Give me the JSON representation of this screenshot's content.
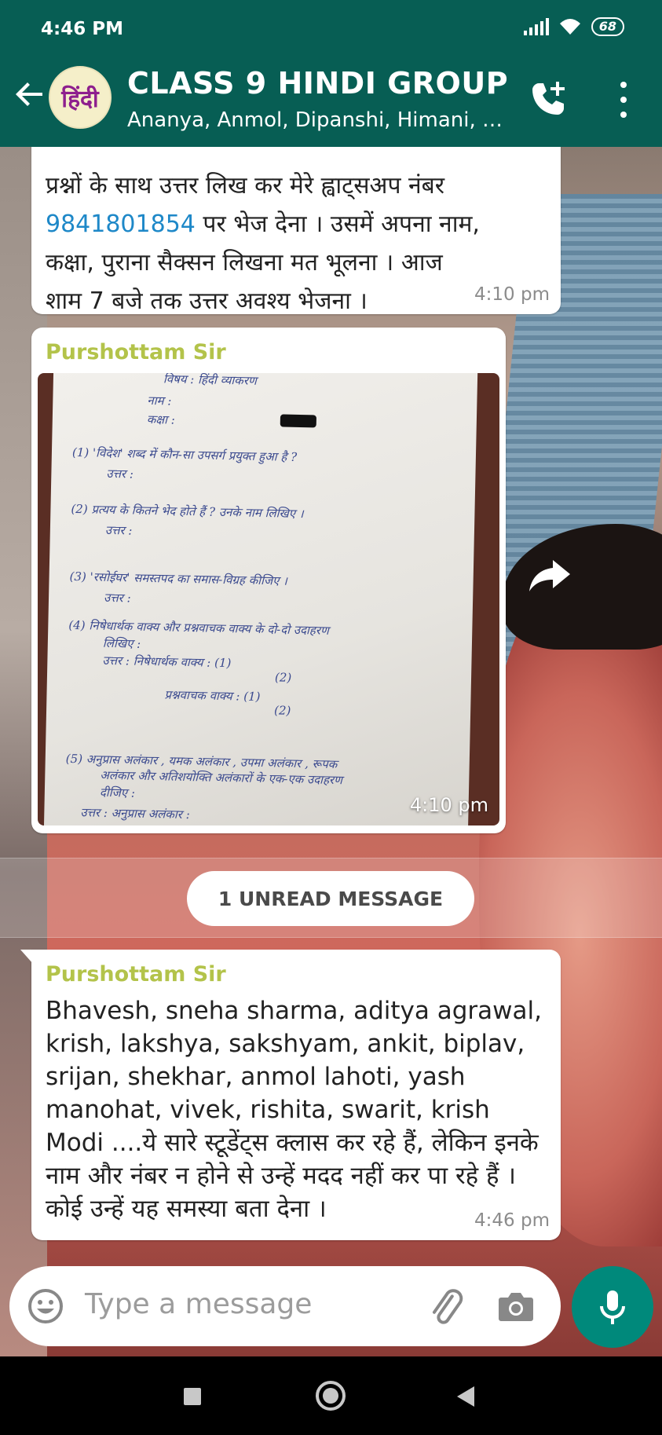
{
  "status_bar": {
    "time": "4:46 PM",
    "battery": "68"
  },
  "header": {
    "title": "CLASS 9 HINDI GROUP",
    "subtitle": "Ananya, Anmol, Dipanshi, Himani, Ka...",
    "avatar_text": "हिंदी",
    "icons": [
      "back-arrow-icon",
      "add-call-icon",
      "more-vert-icon"
    ]
  },
  "messages": [
    {
      "type": "text",
      "text_before": "प्रश्नों के साथ उत्तर लिख कर मेरे ह्वाट्सअप नंबर",
      "phone": "9841801854",
      "text_after_phone": " पर भेज देना । उसमें अपना नाम,",
      "line3": "कक्षा, पुराना सैक्सन लिखना मत भूलना । आज",
      "line4": "शाम 7 बजे तक उत्तर अवश्य भेजना ।",
      "time": "4:10 pm"
    },
    {
      "type": "image",
      "sender": "Purshottam Sir",
      "time": "4:10 pm",
      "worksheet_lines": [
        "विषय : हिंदी व्याकरण",
        "नाम :",
        "कक्षा :",
        "(1) 'विदेश' शब्द में कौन-सा उपसर्ग प्रयुक्त हुआ है ?",
        "उत्तर :",
        "(2) प्रत्यय के कितने भेद होते हैं ? उनके नाम लिखिए ।",
        "उत्तर :",
        "(3) 'रसोईघर' समस्तपद का समास-विग्रह कीजिए ।",
        "उत्तर :",
        "(4) निषेधार्थक वाक्य और प्रश्नवाचक वाक्य के दो-दो उदाहरण",
        "लिखिए :",
        "उत्तर : निषेधार्थक वाक्य : (1)",
        "(2)",
        "प्रश्नवाचक वाक्य : (1)",
        "(2)",
        "(5) अनुप्रास अलंकार , यमक अलंकार , उपमा अलंकार , रूपक",
        "अलंकार और अतिशयोक्ति अलंकारों के एक-एक उदाहरण",
        "दीजिए :",
        "उत्तर : अनुप्रास अलंकार :"
      ]
    },
    {
      "type": "text",
      "sender": "Purshottam Sir",
      "body": "Bhavesh, sneha sharma, aditya agrawal, krish, lakshya, sakshyam, ankit, biplav, srijan, shekhar, anmol lahoti,  yash manohat, vivek, rishita, swarit, krish Modi ....ये सारे स्टूडेंट्स क्लास कर रहे हैं, लेकिन इनके नाम और नंबर न होने से उन्हें मदद नहीं कर पा रहे हैं । कोई उन्हें यह समस्या बता देना ।",
      "time": "4:46 pm"
    }
  ],
  "unread_label": "1 UNREAD MESSAGE",
  "composer": {
    "placeholder": "Type a message",
    "icons": [
      "emoji-icon",
      "attach-icon",
      "camera-icon",
      "mic-icon"
    ]
  },
  "colors": {
    "header": "#075e54",
    "sender": "#b3c34a",
    "link": "#1e88c8",
    "mic_button": "#00897b"
  }
}
